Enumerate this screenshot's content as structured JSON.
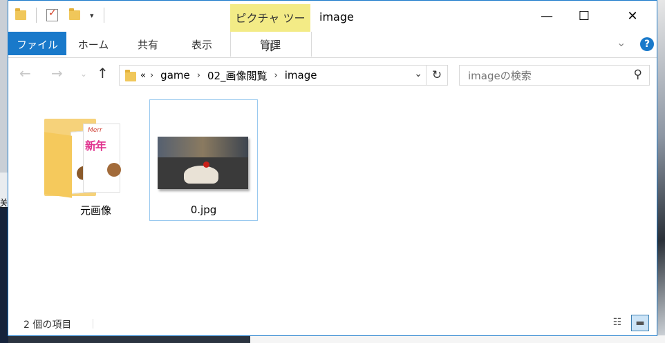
{
  "window": {
    "title": "image",
    "context_tab": "ピクチャ ツール",
    "controls": {
      "minimize": "—",
      "maximize": "☐",
      "close": "✕"
    }
  },
  "ribbon": {
    "tabs": [
      "ファイル",
      "ホーム",
      "共有",
      "表示",
      "管理"
    ],
    "help": "?"
  },
  "address": {
    "prefix": "«",
    "crumbs": [
      "game",
      "02_画像閲覧",
      "image"
    ]
  },
  "search": {
    "placeholder": "imageの検索"
  },
  "items": [
    {
      "name": "元画像",
      "type": "folder",
      "thumb_text": [
        "Merr",
        "新年"
      ]
    },
    {
      "name": "0.jpg",
      "type": "image"
    }
  ],
  "status": {
    "count_text": "2 個の項目"
  },
  "desktop": {
    "left_clip": "送"
  },
  "colors": {
    "accent": "#1979ca",
    "context": "#f3eb86",
    "selection": "#99c9ef"
  }
}
